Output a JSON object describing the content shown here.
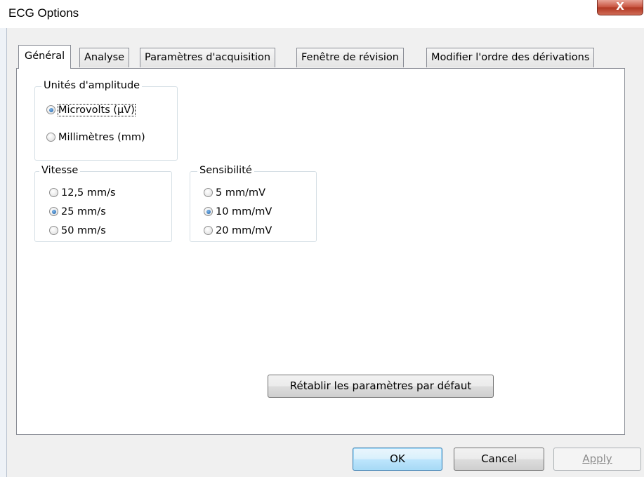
{
  "window": {
    "title": "ECG Options",
    "close_glyph": "X"
  },
  "tabs": [
    {
      "label": "Général",
      "active": true
    },
    {
      "label": "Analyse"
    },
    {
      "label": "Paramètres d'acquisition"
    },
    {
      "label": "Fenêtre de révision"
    },
    {
      "label": "Modifier l'ordre des dérivations"
    }
  ],
  "amplitude": {
    "legend": "Unités d'amplitude",
    "options": [
      {
        "label": "Microvolts (µV)",
        "checked": true
      },
      {
        "label": "Millimètres (mm)",
        "checked": false
      }
    ]
  },
  "vitesse": {
    "legend": "Vitesse",
    "options": [
      {
        "label": "12,5 mm/s",
        "checked": false
      },
      {
        "label": "25 mm/s",
        "checked": true
      },
      {
        "label": "50 mm/s",
        "checked": false
      }
    ]
  },
  "sensibilite": {
    "legend": "Sensibilité",
    "options": [
      {
        "label": "5 mm/mV",
        "checked": false
      },
      {
        "label": "10 mm/mV",
        "checked": true
      },
      {
        "label": "20 mm/mV",
        "checked": false
      }
    ]
  },
  "buttons": {
    "reset": "Rétablir les paramètres par défaut",
    "ok": "OK",
    "cancel": "Cancel",
    "apply": "Apply"
  }
}
